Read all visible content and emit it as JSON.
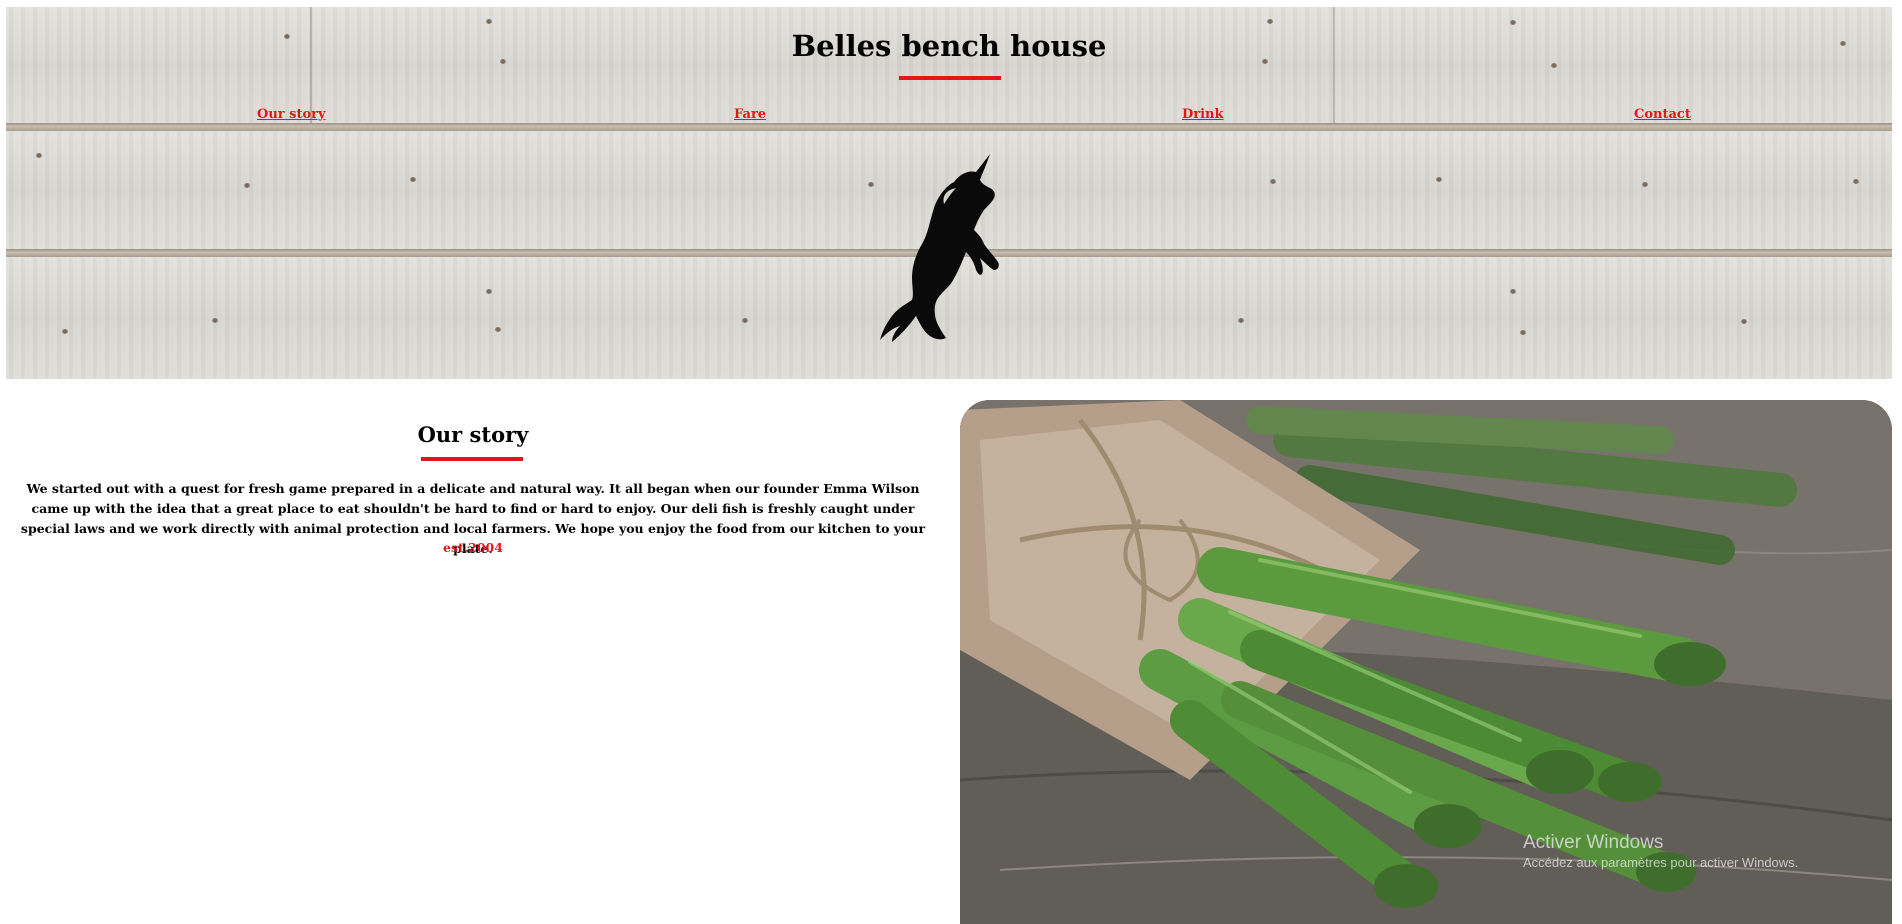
{
  "header": {
    "site_title": "Belles bench house",
    "nav": [
      {
        "label": "Our story"
      },
      {
        "label": "Fare"
      },
      {
        "label": "Drink"
      },
      {
        "label": "Contact"
      }
    ],
    "logo_icon": "unicorn-icon"
  },
  "story": {
    "heading": "Our story",
    "body": "We started out with a quest for fresh game prepared in a delicate and natural way. It all began when our founder Emma Wilson came up with the idea that a great place to eat shouldn't be hard to find or hard to enjoy. Our deli fish is freshly caught under special laws and we work directly with animal protection and local farmers. We hope you enjoy the food from our kitchen to your plate.",
    "established": "est.2004"
  },
  "photo": {
    "subject": "asparagus-bundle-image"
  },
  "watermark": {
    "title": "Activer Windows",
    "subtitle": "Accédez aux paramètres pour activer Windows."
  },
  "colors": {
    "accent": "#e3161b",
    "text": "#000000",
    "wood": "#dcdad4"
  }
}
